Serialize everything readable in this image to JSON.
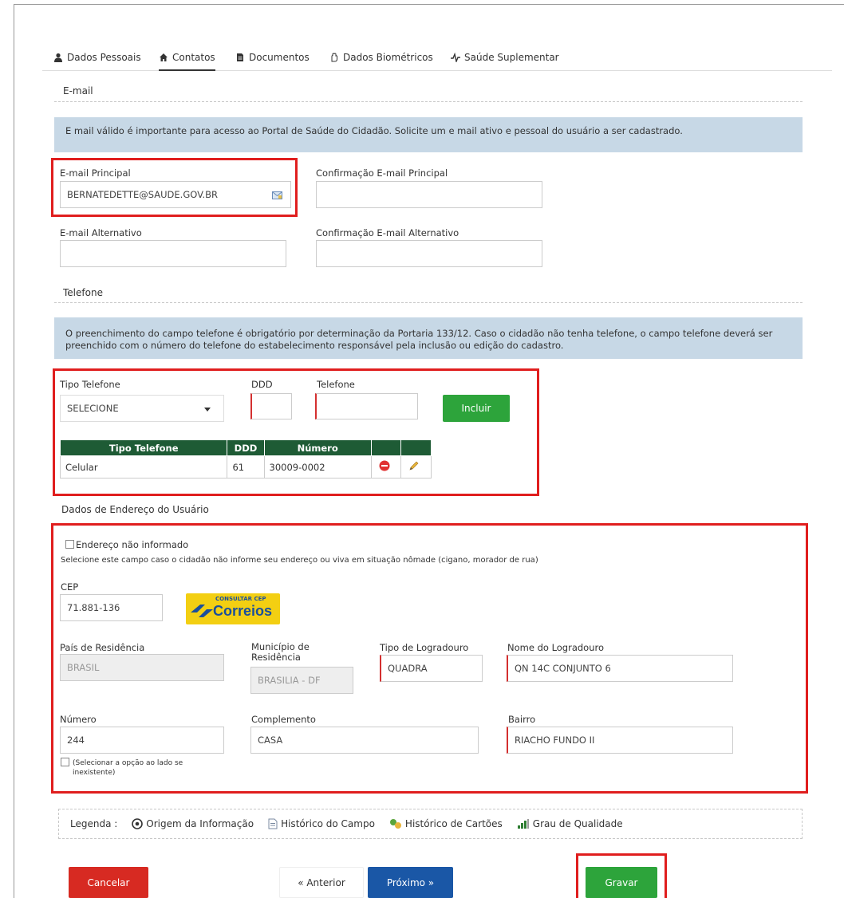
{
  "tabs": [
    {
      "label": "Dados Pessoais",
      "icon": "user-icon"
    },
    {
      "label": "Contatos",
      "icon": "home-icon",
      "active": true
    },
    {
      "label": "Documentos",
      "icon": "document-icon"
    },
    {
      "label": "Dados Biométricos",
      "icon": "hand-icon"
    },
    {
      "label": "Saúde Suplementar",
      "icon": "pulse-icon"
    }
  ],
  "email": {
    "section_title": "E-mail",
    "info": "E mail válido é importante para acesso ao Portal de Saúde do Cidadão. Solicite um e mail ativo e pessoal do usuário a ser cadastrado.",
    "principal_label": "E-mail Principal",
    "principal_value": "BERNATEDETTE@SAUDE.GOV.BR",
    "confirm_principal_label": "Confirmação E-mail Principal",
    "confirm_principal_value": "",
    "alt_label": "E-mail Alternativo",
    "alt_value": "",
    "confirm_alt_label": "Confirmação E-mail Alternativo",
    "confirm_alt_value": ""
  },
  "phone": {
    "section_title": "Telefone",
    "info": "O preenchimento do campo telefone é obrigatório por determinação da Portaria 133/12. Caso o cidadão não tenha telefone, o campo telefone deverá ser preenchido com o número do telefone do estabelecimento responsável pela inclusão ou edição do cadastro.",
    "type_label": "Tipo Telefone",
    "type_value": "SELECIONE",
    "ddd_label": "DDD",
    "ddd_value": "",
    "number_label": "Telefone",
    "number_value": "",
    "include_button": "Incluir",
    "table": {
      "headers": [
        "Tipo Telefone",
        "DDD",
        "Número",
        "",
        ""
      ],
      "rows": [
        {
          "type": "Celular",
          "ddd": "61",
          "number": "30009-0002"
        }
      ]
    }
  },
  "address": {
    "section_title": "Dados de Endereço do Usuário",
    "not_informed_label": "Endereço não informado",
    "not_informed_hint": "Selecione este campo caso o cidadão não informe seu endereço ou viva em situação nômade (cigano, morador de rua)",
    "cep_label": "CEP",
    "cep_value": "71.881-136",
    "correios_small": "CONSULTAR CEP",
    "correios_big": "Correios",
    "country_label": "País de Residência",
    "country_value": "BRASIL",
    "city_label": "Município de Residência",
    "city_value": "BRASILIA - DF",
    "street_type_label": "Tipo de Logradouro",
    "street_type_value": "QUADRA",
    "street_name_label": "Nome do Logradouro",
    "street_name_value": "QN 14C CONJUNTO 6",
    "number_label": "Número",
    "number_value": "244",
    "complement_label": "Complemento",
    "complement_value": "CASA",
    "district_label": "Bairro",
    "district_value": "RIACHO FUNDO II",
    "no_number_label": "(Selecionar a opção ao lado se inexistente)"
  },
  "legend": {
    "title": "Legenda :",
    "items": [
      "Origem da Informação",
      "Histórico do Campo",
      "Histórico de Cartões",
      "Grau de Qualidade"
    ]
  },
  "buttons": {
    "cancel": "Cancelar",
    "previous": "« Anterior",
    "next": "Próximo »",
    "save": "Gravar"
  }
}
